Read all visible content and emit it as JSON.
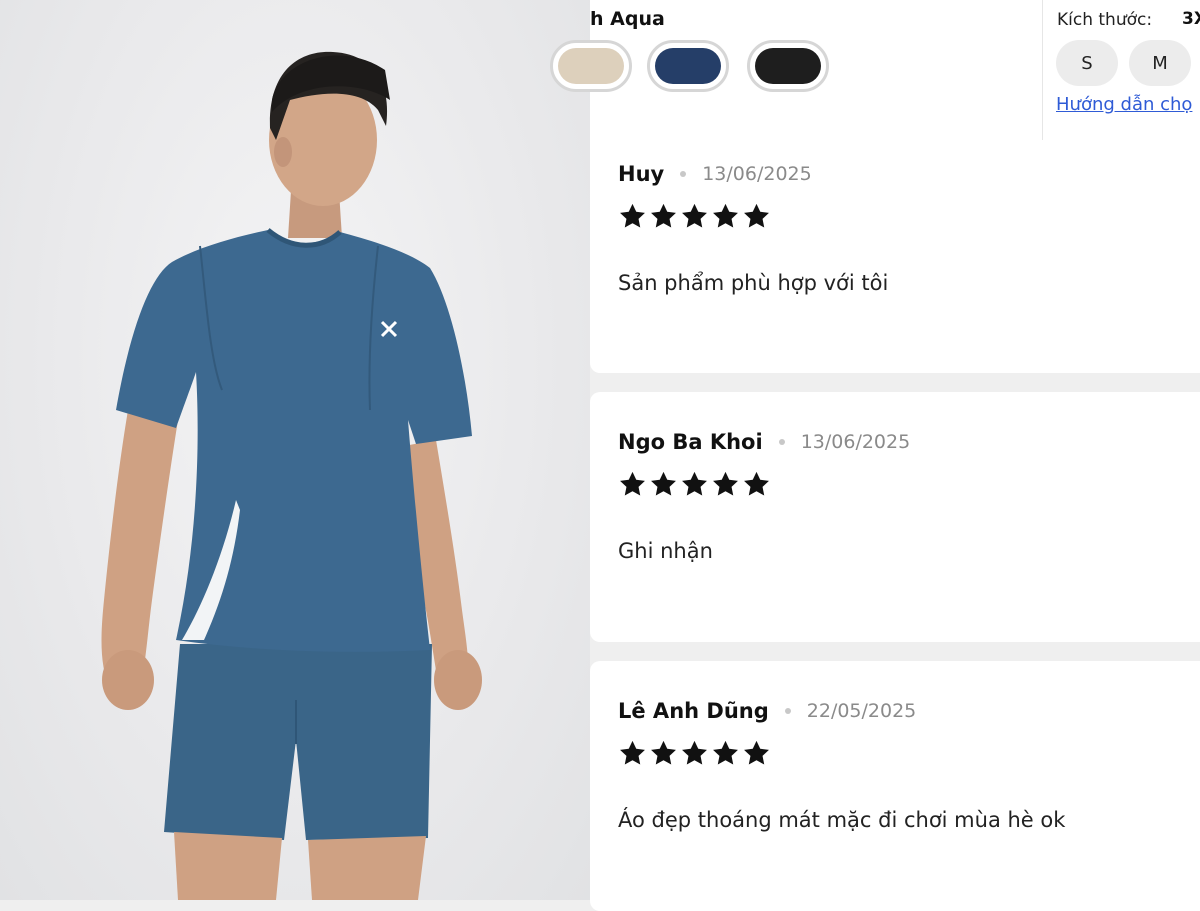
{
  "product": {
    "selected_color_name": "h Aqua",
    "colors": [
      {
        "name": "beige",
        "hex": "#ddd0bc"
      },
      {
        "name": "navy",
        "hex": "#253e68"
      },
      {
        "name": "black",
        "hex": "#1e1e1e"
      }
    ],
    "size_label": "Kích thước:",
    "size_value": "3X",
    "sizes": [
      "S",
      "M"
    ],
    "size_guide_link": "Hướng dẫn chọ"
  },
  "reviews": [
    {
      "name": "Huy",
      "date": "13/06/2025",
      "rating": 5,
      "text": "Sản phẩm phù hợp với tôi"
    },
    {
      "name": "Ngo Ba Khoi",
      "date": "13/06/2025",
      "rating": 5,
      "text": "Ghi nhận"
    },
    {
      "name": "Lê Anh Dũng",
      "date": "22/05/2025",
      "rating": 5,
      "text": "Áo đẹp thoáng mát mặc đi chơi mùa hè ok"
    }
  ],
  "colors": {
    "link": "#2f5bd6",
    "star": "#111111",
    "shirt": "#3d6990"
  }
}
